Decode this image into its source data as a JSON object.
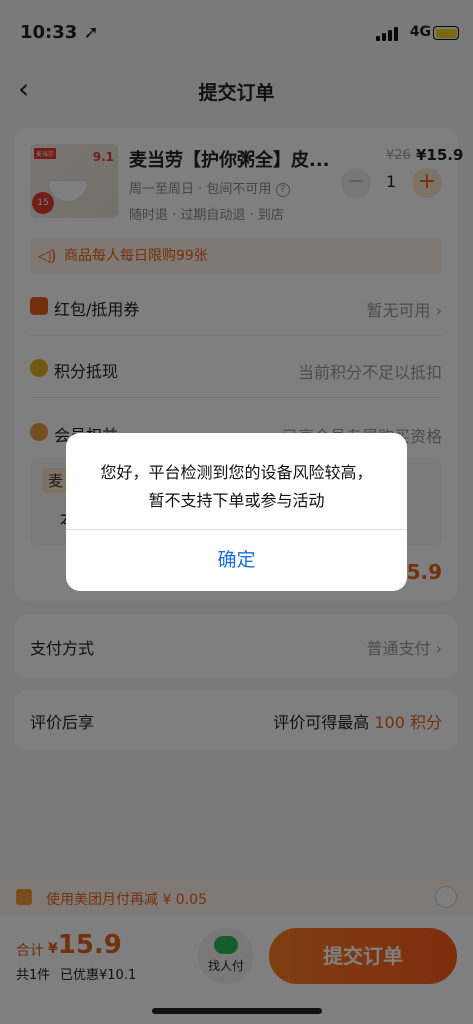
{
  "status_bar": {
    "time": "10:33 ➚",
    "network": "4G"
  },
  "nav": {
    "title": "提交订单"
  },
  "product": {
    "name": "麦当劳【护你粥全】皮...",
    "original_price": "¥26",
    "price": "¥15.9",
    "availability": "周一至周日 · 包间不可用",
    "refund_policy": "随时退 · 过期自动退 · 到店",
    "quantity": "1",
    "minus": "−",
    "plus": "+",
    "thumb_price": "9.1",
    "thumb_badge": "15",
    "limit_notice": "商品每人每日限购99张"
  },
  "rows": {
    "coupon_label": "红包/抵用券",
    "coupon_value": "暂无可用 ›",
    "points_label": "积分抵现",
    "points_value": "当前积分不足以抵扣",
    "member_label": "会员权益",
    "member_value": "已享会员专属购买资格"
  },
  "member_box": {
    "tag": "麦",
    "text": "本"
  },
  "subtotal": "5.9",
  "payment": {
    "label": "支付方式",
    "value": "普通支付 ›"
  },
  "review": {
    "label": "评价后享",
    "value_prefix": "评价可得最高",
    "value_highlight": "100 积分"
  },
  "cashback": {
    "text": "使用美团月付再减 ¥ 0.05"
  },
  "bottom_bar": {
    "total_label": "合计",
    "currency": "¥",
    "total": "15.9",
    "count": "共1件",
    "discount": "已优惠¥10.1",
    "helper_label": "找人付",
    "submit_label": "提交订单"
  },
  "dialog": {
    "message_line1": "您好，平台检测到您的设备风险较高，",
    "message_line2": "暂不支持下单或参与活动",
    "confirm_label": "确定"
  },
  "colors": {
    "accent": "#e8601a",
    "dialog_button": "#1a6fd6"
  }
}
